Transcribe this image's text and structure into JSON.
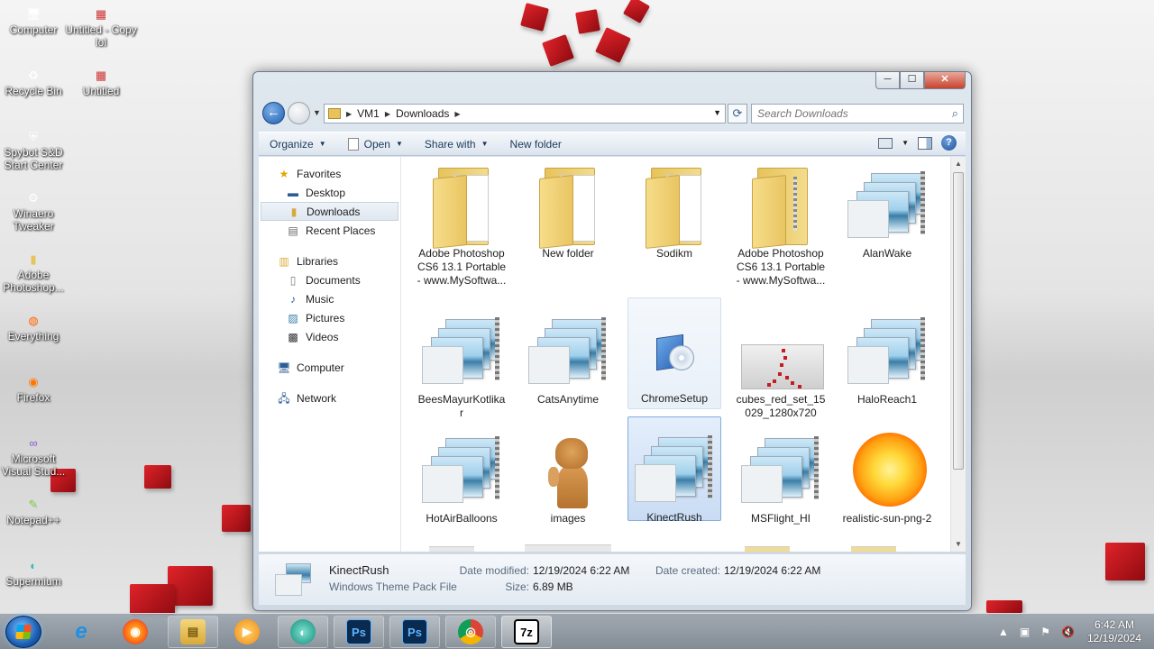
{
  "desktop": {
    "icons": [
      {
        "label": "Computer",
        "icon": "computer-icon"
      },
      {
        "label": "Untitled - Copy lol",
        "icon": "image-file-icon"
      },
      {
        "label": "Recycle Bin",
        "icon": "recycle-bin-icon"
      },
      {
        "label": "Untitled",
        "icon": "image-file-icon"
      },
      {
        "label": "Spybot S&D Start Center",
        "icon": "spybot-icon"
      },
      {
        "label": "Winaero Tweaker",
        "icon": "winaero-icon"
      },
      {
        "label": "Adobe Photoshop...",
        "icon": "folder-icon"
      },
      {
        "label": "Everything",
        "icon": "everything-icon"
      },
      {
        "label": "Firefox",
        "icon": "firefox-icon"
      },
      {
        "label": "Microsoft Visual Stud...",
        "icon": "visual-studio-icon"
      },
      {
        "label": "Notepad++",
        "icon": "notepad-plus-icon"
      },
      {
        "label": "Supermium",
        "icon": "supermium-icon"
      }
    ]
  },
  "window": {
    "caption": {
      "minimize": "─",
      "maximize": "☐",
      "close": "✕"
    },
    "address": {
      "crumbs": [
        "VM1",
        "Downloads"
      ]
    },
    "search": {
      "placeholder": "Search Downloads"
    },
    "toolbar": {
      "organize": "Organize",
      "open": "Open",
      "share_with": "Share with",
      "new_folder": "New folder"
    },
    "nav_pane": {
      "favorites": {
        "title": "Favorites",
        "items": [
          "Desktop",
          "Downloads",
          "Recent Places"
        ]
      },
      "libraries": {
        "title": "Libraries",
        "items": [
          "Documents",
          "Music",
          "Pictures",
          "Videos"
        ]
      },
      "computer": "Computer",
      "network": "Network"
    },
    "files": [
      {
        "label": "Adobe Photoshop CS6 13.1 Portable - www.MySoftwa...",
        "kind": "folder"
      },
      {
        "label": "New folder",
        "kind": "folder"
      },
      {
        "label": "Sodikm",
        "kind": "folder"
      },
      {
        "label": "Adobe Photoshop CS6 13.1 Portable - www.MySoftwa...",
        "kind": "zip"
      },
      {
        "label": "AlanWake",
        "kind": "theme"
      },
      {
        "label": "BeesMayurKotlikar",
        "kind": "theme"
      },
      {
        "label": "CatsAnytime",
        "kind": "theme"
      },
      {
        "label": "ChromeSetup",
        "kind": "setup"
      },
      {
        "label": "cubes_red_set_15029_1280x720",
        "kind": "image"
      },
      {
        "label": "HaloReach1",
        "kind": "theme"
      },
      {
        "label": "HotAirBalloons",
        "kind": "theme"
      },
      {
        "label": "images",
        "kind": "dog"
      },
      {
        "label": "KinectRush",
        "kind": "theme"
      },
      {
        "label": "MSFlight_HI",
        "kind": "theme"
      },
      {
        "label": "realistic-sun-png-2",
        "kind": "sun"
      }
    ],
    "details": {
      "name": "KinectRush",
      "type": "Windows Theme Pack File",
      "date_modified_label": "Date modified:",
      "date_modified": "12/19/2024 6:22 AM",
      "date_created_label": "Date created:",
      "date_created": "12/19/2024 6:22 AM",
      "size_label": "Size:",
      "size": "6.89 MB"
    }
  },
  "taskbar": {
    "apps": [
      {
        "name": "internet-explorer",
        "glyph": "e"
      },
      {
        "name": "firefox",
        "glyph": "◉"
      },
      {
        "name": "file-explorer",
        "glyph": "▤"
      },
      {
        "name": "media-player",
        "glyph": "▶"
      },
      {
        "name": "supermium",
        "glyph": "◐"
      },
      {
        "name": "photoshop-portable",
        "glyph": "Ps"
      },
      {
        "name": "photoshop",
        "glyph": "Ps"
      },
      {
        "name": "chrome",
        "glyph": "◎"
      },
      {
        "name": "7zip",
        "glyph": "7z"
      }
    ],
    "clock": {
      "time": "6:42 AM",
      "date": "12/19/2024"
    }
  },
  "colors": {
    "accent": "#1b5fb5",
    "cube_red": "#c41c22",
    "selected_bg": "#c9dcf4"
  }
}
